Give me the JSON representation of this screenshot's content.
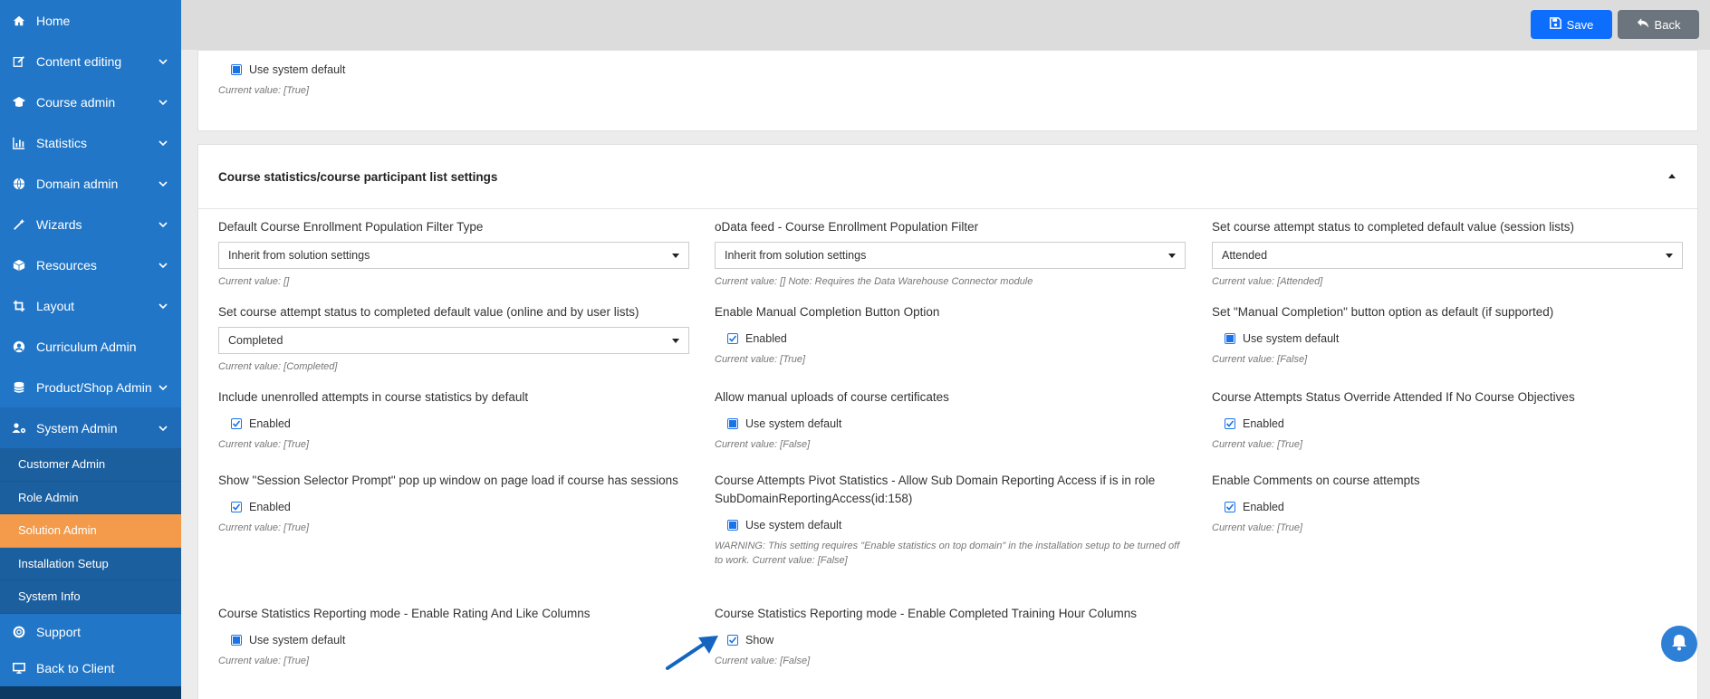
{
  "sidebar": {
    "items": [
      {
        "label": "Home",
        "icon": "home-icon"
      },
      {
        "label": "Content editing",
        "icon": "edit-icon"
      },
      {
        "label": "Course admin",
        "icon": "graduation-cap-icon"
      },
      {
        "label": "Statistics",
        "icon": "bar-chart-icon"
      },
      {
        "label": "Domain admin",
        "icon": "globe-icon"
      },
      {
        "label": "Wizards",
        "icon": "magic-wand-icon"
      },
      {
        "label": "Resources",
        "icon": "cube-icon"
      },
      {
        "label": "Layout",
        "icon": "crop-icon"
      },
      {
        "label": "Curriculum Admin",
        "icon": "user-circle-icon"
      },
      {
        "label": "Product/Shop Admin",
        "icon": "database-icon"
      },
      {
        "label": "System Admin",
        "icon": "users-cog-icon"
      }
    ],
    "subitems": [
      {
        "label": "Customer Admin"
      },
      {
        "label": "Role Admin"
      },
      {
        "label": "Solution Admin"
      },
      {
        "label": "Installation Setup"
      },
      {
        "label": "System Info"
      }
    ],
    "bottom_items": [
      {
        "label": "Support",
        "icon": "life-ring-icon"
      },
      {
        "label": "Back to Client",
        "icon": "monitor-icon"
      }
    ]
  },
  "toolbar": {
    "save_label": "Save",
    "back_label": "Back"
  },
  "top_card": {
    "checkbox_label": "Use system default",
    "current": "Current value: [True]"
  },
  "section": {
    "title": "Course statistics/course participant list settings"
  },
  "settings": {
    "r1c1": {
      "label": "Default Course Enrollment Population Filter Type",
      "value": "Inherit from solution settings",
      "current": "Current value: []"
    },
    "r1c2": {
      "label": "oData feed - Course Enrollment Population Filter",
      "value": "Inherit from solution settings",
      "current": "Current value: [] Note: Requires the Data Warehouse Connector module"
    },
    "r1c3": {
      "label": "Set course attempt status to completed default value (session lists)",
      "value": "Attended",
      "current": "Current value: [Attended]"
    },
    "r2c1": {
      "label": "Set course attempt status to completed default value (online and by user lists)",
      "value": "Completed",
      "current": "Current value: [Completed]"
    },
    "r2c2": {
      "label": "Enable Manual Completion Button Option",
      "check": "Enabled",
      "current": "Current value: [True]"
    },
    "r2c3": {
      "label": "Set \"Manual Completion\" button option as default (if supported)",
      "check": "Use system default",
      "current": "Current value: [False]"
    },
    "r3c1": {
      "label": "Include unenrolled attempts in course statistics by default",
      "check": "Enabled",
      "current": "Current value: [True]"
    },
    "r3c2": {
      "label": "Allow manual uploads of course certificates",
      "check": "Use system default",
      "current": "Current value: [False]"
    },
    "r3c3": {
      "label": "Course Attempts Status Override Attended If No Course Objectives",
      "check": "Enabled",
      "current": "Current value: [True]"
    },
    "r4c1": {
      "label": "Show \"Session Selector Prompt\" pop up window on page load if course has sessions",
      "check": "Enabled",
      "current": "Current value: [True]"
    },
    "r4c2": {
      "label": "Course Attempts Pivot Statistics - Allow Sub Domain Reporting Access if is in role SubDomainReportingAccess(id:158)",
      "check": "Use system default",
      "current": "WARNING: This setting requires \"Enable statistics on top domain\" in the installation setup to be turned off to work. Current value: [False]"
    },
    "r4c3": {
      "label": "Enable Comments on course attempts",
      "check": "Enabled",
      "current": "Current value: [True]"
    },
    "r5c1": {
      "label": "Course Statistics Reporting mode - Enable Rating And Like Columns",
      "check": "Use system default",
      "current": "Current value: [True]"
    },
    "r5c2": {
      "label": "Course Statistics Reporting mode - Enable Completed Training Hour Columns",
      "check": "Show",
      "current": "Current value: [False]"
    }
  },
  "colors": {
    "sidebar": "#2176c7",
    "active_item": "#f39b4b",
    "primary": "#0d6efd",
    "secondary": "#6c757d"
  }
}
